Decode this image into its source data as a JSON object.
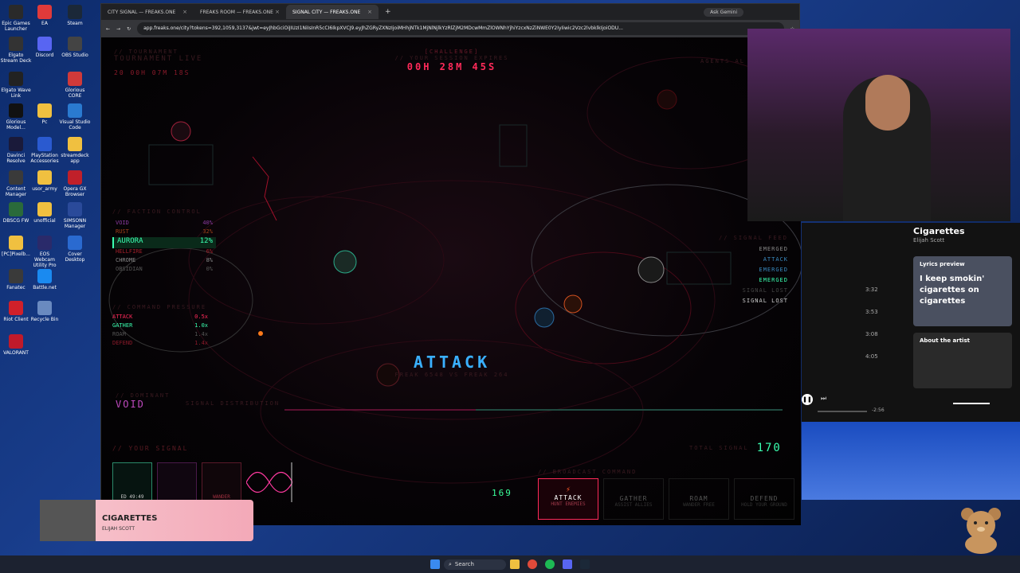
{
  "desktop": {
    "icons": [
      {
        "label": "Epic Games Launcher"
      },
      {
        "label": "EA"
      },
      {
        "label": "Steam"
      },
      {
        "label": "Elgato Stream Deck"
      },
      {
        "label": "Discord"
      },
      {
        "label": "OBS Studio"
      },
      {
        "label": "Elgato Wave Link"
      },
      {
        "label": "Glorious CORE"
      },
      {
        "label": "Glorious Model..."
      },
      {
        "label": "Pc"
      },
      {
        "label": "Visual Studio Code"
      },
      {
        "label": "Davinci Resolve"
      },
      {
        "label": "PlayStation Accessories"
      },
      {
        "label": "streamdeck app"
      },
      {
        "label": "Content Manager"
      },
      {
        "label": "usor_army"
      },
      {
        "label": "Opera GX Browser"
      },
      {
        "label": "DBSCG FW"
      },
      {
        "label": "unofficial"
      },
      {
        "label": "SIMSONN Manager"
      },
      {
        "label": "[PC]Pixelb..."
      },
      {
        "label": "EOS Webcam Utility Pro"
      },
      {
        "label": "Cover Desktop"
      },
      {
        "label": "Fanatec"
      },
      {
        "label": "Battle.net"
      },
      {
        "label": "Riot Client"
      },
      {
        "label": "Recycle Bin"
      },
      {
        "label": "VALORANT"
      }
    ]
  },
  "browser": {
    "tabs": [
      {
        "label": "CITY SIGNAL — FREAKS.ONE"
      },
      {
        "label": "FREAKS ROOM — FREAKS.ONE"
      },
      {
        "label": "SIGNAL CITY — FREAKS.ONE"
      }
    ],
    "ask_gemini": "Ask Gemini",
    "url": "app.freaks.one/city?tokens=392,1059,3137&jwt=eyJhbGciOiJIUzI1NiIsInR5cCI6IkpXVCJ9.eyJhZGRyZXNzIjoiMHhjNTk1MjNlNjlkYzRlZjM2MDcwMmZlOWNhYjhiYzcxNzZiNWE0Y2IyIiwic2Vzc2lvbklkIjoiODU..."
  },
  "game": {
    "tournament_label": "// TOURNAMENT",
    "tournament_status": "TOURNAMENT LIVE",
    "tournament_timer": "20 00H 07M 18S",
    "challenge_label": "[CHALLENGE]",
    "session_label": "// YOUR SESSION EXPIRES",
    "session_timer": "00H 28M 45S",
    "agents_label": "AGENTS AL",
    "faction_label": "// FACTION CONTROL",
    "factions": [
      {
        "name": "VOID",
        "value": "40%"
      },
      {
        "name": "RUST",
        "value": "32%"
      },
      {
        "name": "AURORA",
        "value": "12%"
      },
      {
        "name": "HELLFIRE",
        "value": "6%"
      },
      {
        "name": "CHROME",
        "value": "8%"
      },
      {
        "name": "OBSIDIAN",
        "value": "0%"
      }
    ],
    "pressure_label": "// COMMAND PRESSURE",
    "pressure": [
      {
        "name": "ATTACK",
        "value": "0.5x"
      },
      {
        "name": "GATHER",
        "value": "1.0x"
      },
      {
        "name": "ROAM",
        "value": "1.4x"
      },
      {
        "name": "DEFEND",
        "value": "1.4x"
      }
    ],
    "signal_feed_label": "// SIGNAL FEED",
    "feed": [
      "EMERGED",
      "ATTACK",
      "EMERGED",
      "EMERGED",
      "SIGNAL LOST",
      "SIGNAL LOST"
    ],
    "center_action": "ATTACK",
    "center_sub": "FREAK 6548 VS FREAK 264",
    "dominant_label": "// DOMINANT",
    "dominant_value": "VOID",
    "distribution_label": "SIGNAL DISTRIBUTION",
    "your_signal_label": "// YOUR SIGNAL",
    "freak_card_tag": "ED 49:49",
    "freak_card_tag2": "WANDER",
    "signal_count": "169",
    "total_signal_label": "TOTAL SIGNAL",
    "total_signal": "170",
    "broadcast_label": "// BROADCAST COMMAND",
    "commands": [
      {
        "label": "ATTACK",
        "sub": "HUNT ENEMIES"
      },
      {
        "label": "GATHER",
        "sub": "ASSIST ALLIES"
      },
      {
        "label": "ROAM",
        "sub": "WANDER FREE"
      },
      {
        "label": "DEFEND",
        "sub": "HOLD YOUR GROUND"
      }
    ]
  },
  "spotify": {
    "track": "Cigarettes",
    "artist": "Elijah Scott",
    "lyrics_title": "Lyrics preview",
    "lyrics": "I keep smokin' cigarettes on cigarettes",
    "about": "About the artist",
    "durations": [
      "3:32",
      "3:53",
      "3:08",
      "4:05"
    ],
    "remaining": "-2:56"
  },
  "now_playing": {
    "title": "CIGARETTES",
    "artist": "ELIJAH SCOTT"
  },
  "taskbar": {
    "search": "Search"
  }
}
